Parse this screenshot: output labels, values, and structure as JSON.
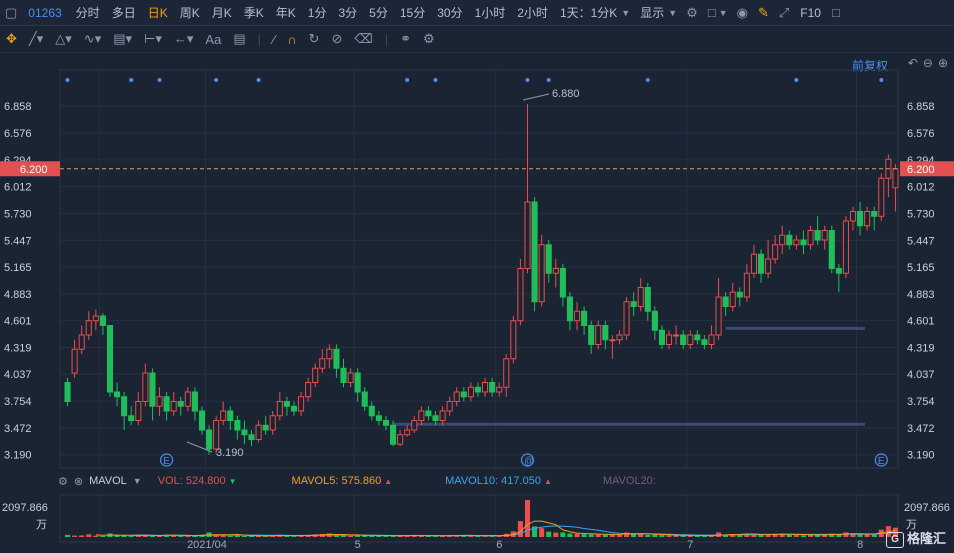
{
  "toolbar": {
    "symbol": "01263",
    "periods": [
      "分时",
      "多日",
      "日K",
      "周K",
      "月K",
      "季K",
      "年K",
      "1分",
      "3分",
      "5分",
      "15分",
      "30分",
      "1小时",
      "2小时"
    ],
    "active_period": "日K",
    "combo_label": "1天：1分K",
    "display_label": "显示",
    "f10_label": "F10"
  },
  "adjust_label": "前复权",
  "price_axis": {
    "ticks": [
      "6.858",
      "6.576",
      "6.294",
      "6.012",
      "5.730",
      "5.447",
      "5.165",
      "4.883",
      "4.601",
      "4.319",
      "4.037",
      "3.754",
      "3.472",
      "3.190"
    ],
    "current_price": "6.200"
  },
  "annotations": {
    "high": "6.880",
    "low": "3.190"
  },
  "event_markers": [
    "E",
    "@",
    "E"
  ],
  "x_axis": {
    "labels": [
      "2021/04",
      "5",
      "6",
      "7",
      "8"
    ]
  },
  "volume_panel": {
    "indicator": "MAVOL",
    "vol": "VOL: 524.800",
    "mavol5": "MAVOL5: 575.860",
    "mavol10": "MAVOL10: 417.050",
    "mavol20": "MAVOL20:",
    "max_label": "2097.866",
    "unit": "万"
  },
  "colors": {
    "up": "#ec4d4d",
    "down": "#1fbe5a",
    "mavol5": "#f0a020",
    "mavol10": "#3ca5f0",
    "mavol20": "#c66bd1",
    "accent": "#4d8ef0"
  },
  "chart_data": {
    "type": "candlestick",
    "ylim": [
      3.05,
      7.05
    ],
    "candles": [
      [
        3.95,
        3.75,
        4.0,
        3.7
      ],
      [
        4.05,
        4.3,
        4.4,
        4.0
      ],
      [
        4.3,
        4.45,
        4.55,
        4.25
      ],
      [
        4.45,
        4.6,
        4.7,
        4.4
      ],
      [
        4.6,
        4.65,
        4.72,
        4.5
      ],
      [
        4.65,
        4.55,
        4.68,
        4.45
      ],
      [
        4.55,
        3.85,
        4.55,
        3.8
      ],
      [
        3.85,
        3.8,
        3.95,
        3.7
      ],
      [
        3.8,
        3.6,
        3.85,
        3.45
      ],
      [
        3.6,
        3.55,
        3.7,
        3.5
      ],
      [
        3.55,
        3.75,
        3.85,
        3.5
      ],
      [
        3.75,
        4.05,
        4.15,
        3.7
      ],
      [
        4.05,
        3.7,
        4.1,
        3.55
      ],
      [
        3.7,
        3.8,
        3.9,
        3.6
      ],
      [
        3.8,
        3.65,
        3.85,
        3.55
      ],
      [
        3.65,
        3.75,
        3.85,
        3.6
      ],
      [
        3.75,
        3.7,
        3.8,
        3.6
      ],
      [
        3.7,
        3.85,
        3.9,
        3.65
      ],
      [
        3.85,
        3.65,
        3.9,
        3.55
      ],
      [
        3.65,
        3.45,
        3.7,
        3.4
      ],
      [
        3.45,
        3.25,
        3.5,
        3.19
      ],
      [
        3.25,
        3.55,
        3.6,
        3.2
      ],
      [
        3.55,
        3.65,
        3.75,
        3.5
      ],
      [
        3.65,
        3.55,
        3.7,
        3.45
      ],
      [
        3.55,
        3.45,
        3.6,
        3.35
      ],
      [
        3.45,
        3.4,
        3.55,
        3.3
      ],
      [
        3.4,
        3.35,
        3.45,
        3.28
      ],
      [
        3.35,
        3.5,
        3.55,
        3.32
      ],
      [
        3.5,
        3.45,
        3.6,
        3.4
      ],
      [
        3.45,
        3.6,
        3.65,
        3.4
      ],
      [
        3.6,
        3.75,
        3.85,
        3.55
      ],
      [
        3.75,
        3.7,
        3.8,
        3.6
      ],
      [
        3.7,
        3.65,
        3.75,
        3.6
      ],
      [
        3.65,
        3.8,
        3.85,
        3.6
      ],
      [
        3.8,
        3.95,
        4.0,
        3.75
      ],
      [
        3.95,
        4.1,
        4.15,
        3.9
      ],
      [
        4.1,
        4.2,
        4.3,
        4.05
      ],
      [
        4.2,
        4.3,
        4.35,
        4.1
      ],
      [
        4.3,
        4.1,
        4.35,
        4.0
      ],
      [
        4.1,
        3.95,
        4.2,
        3.9
      ],
      [
        3.95,
        4.05,
        4.1,
        3.9
      ],
      [
        4.05,
        3.85,
        4.1,
        3.75
      ],
      [
        3.85,
        3.7,
        3.9,
        3.65
      ],
      [
        3.7,
        3.6,
        3.75,
        3.55
      ],
      [
        3.6,
        3.55,
        3.65,
        3.5
      ],
      [
        3.55,
        3.5,
        3.6,
        3.45
      ],
      [
        3.5,
        3.3,
        3.55,
        3.28
      ],
      [
        3.3,
        3.4,
        3.45,
        3.28
      ],
      [
        3.4,
        3.45,
        3.5,
        3.38
      ],
      [
        3.45,
        3.55,
        3.6,
        3.42
      ],
      [
        3.55,
        3.65,
        3.7,
        3.5
      ],
      [
        3.65,
        3.6,
        3.7,
        3.55
      ],
      [
        3.6,
        3.55,
        3.65,
        3.5
      ],
      [
        3.55,
        3.65,
        3.7,
        3.5
      ],
      [
        3.65,
        3.75,
        3.8,
        3.6
      ],
      [
        3.75,
        3.85,
        3.9,
        3.7
      ],
      [
        3.85,
        3.8,
        3.9,
        3.75
      ],
      [
        3.8,
        3.9,
        3.95,
        3.75
      ],
      [
        3.9,
        3.85,
        3.95,
        3.8
      ],
      [
        3.85,
        3.95,
        4.0,
        3.8
      ],
      [
        3.95,
        3.85,
        4.0,
        3.8
      ],
      [
        3.85,
        3.9,
        3.95,
        3.8
      ],
      [
        3.9,
        4.2,
        4.25,
        3.8
      ],
      [
        4.2,
        4.6,
        4.65,
        4.15
      ],
      [
        4.6,
        5.15,
        5.25,
        4.55
      ],
      [
        5.15,
        5.85,
        6.88,
        5.1
      ],
      [
        5.85,
        4.8,
        5.9,
        4.7
      ],
      [
        4.8,
        5.4,
        5.5,
        4.75
      ],
      [
        5.4,
        5.1,
        5.45,
        5.0
      ],
      [
        5.1,
        5.15,
        5.25,
        4.95
      ],
      [
        5.15,
        4.85,
        5.2,
        4.75
      ],
      [
        4.85,
        4.6,
        4.9,
        4.5
      ],
      [
        4.6,
        4.7,
        4.8,
        4.5
      ],
      [
        4.7,
        4.55,
        4.75,
        4.45
      ],
      [
        4.55,
        4.35,
        4.6,
        4.25
      ],
      [
        4.35,
        4.55,
        4.6,
        4.3
      ],
      [
        4.55,
        4.4,
        4.6,
        4.3
      ],
      [
        4.4,
        4.4,
        4.45,
        4.2
      ],
      [
        4.4,
        4.45,
        4.5,
        4.35
      ],
      [
        4.45,
        4.8,
        4.85,
        4.4
      ],
      [
        4.8,
        4.75,
        4.9,
        4.65
      ],
      [
        4.75,
        4.95,
        5.05,
        4.7
      ],
      [
        4.95,
        4.7,
        5.0,
        4.6
      ],
      [
        4.7,
        4.5,
        4.75,
        4.4
      ],
      [
        4.5,
        4.35,
        4.55,
        4.3
      ],
      [
        4.35,
        4.45,
        4.5,
        4.3
      ],
      [
        4.45,
        4.45,
        4.55,
        4.35
      ],
      [
        4.45,
        4.35,
        4.5,
        4.3
      ],
      [
        4.35,
        4.45,
        4.5,
        4.3
      ],
      [
        4.45,
        4.4,
        4.5,
        4.35
      ],
      [
        4.4,
        4.35,
        4.45,
        4.3
      ],
      [
        4.35,
        4.45,
        4.55,
        4.3
      ],
      [
        4.45,
        4.85,
        5.05,
        4.4
      ],
      [
        4.85,
        4.75,
        4.9,
        4.65
      ],
      [
        4.75,
        4.9,
        5.0,
        4.7
      ],
      [
        4.9,
        4.85,
        4.95,
        4.75
      ],
      [
        4.85,
        5.1,
        5.2,
        4.8
      ],
      [
        5.1,
        5.3,
        5.4,
        5.05
      ],
      [
        5.3,
        5.1,
        5.35,
        5.0
      ],
      [
        5.1,
        5.25,
        5.45,
        5.05
      ],
      [
        5.25,
        5.4,
        5.5,
        5.2
      ],
      [
        5.4,
        5.5,
        5.6,
        5.3
      ],
      [
        5.5,
        5.4,
        5.55,
        5.35
      ],
      [
        5.4,
        5.45,
        5.5,
        5.35
      ],
      [
        5.45,
        5.4,
        5.55,
        5.3
      ],
      [
        5.4,
        5.55,
        5.6,
        5.35
      ],
      [
        5.55,
        5.45,
        5.7,
        5.4
      ],
      [
        5.45,
        5.55,
        5.6,
        5.35
      ],
      [
        5.55,
        5.15,
        5.6,
        5.1
      ],
      [
        5.15,
        5.1,
        5.2,
        4.9
      ],
      [
        5.1,
        5.65,
        5.7,
        5.05
      ],
      [
        5.65,
        5.75,
        5.8,
        5.55
      ],
      [
        5.75,
        5.6,
        5.85,
        5.5
      ],
      [
        5.6,
        5.75,
        5.8,
        5.55
      ],
      [
        5.75,
        5.7,
        5.8,
        5.55
      ],
      [
        5.7,
        6.1,
        6.15,
        5.65
      ],
      [
        6.1,
        6.3,
        6.35,
        5.9
      ],
      [
        6.0,
        6.2,
        6.25,
        5.75
      ]
    ],
    "volumes": [
      120,
      80,
      90,
      150,
      70,
      60,
      200,
      90,
      100,
      60,
      80,
      140,
      70,
      90,
      60,
      80,
      70,
      90,
      60,
      100,
      260,
      150,
      90,
      70,
      80,
      60,
      70,
      90,
      60,
      80,
      130,
      70,
      60,
      90,
      120,
      150,
      170,
      200,
      80,
      100,
      70,
      90,
      100,
      60,
      80,
      70,
      110,
      60,
      70,
      80,
      90,
      60,
      70,
      80,
      90,
      100,
      80,
      70,
      60,
      90,
      70,
      60,
      180,
      320,
      900,
      2097,
      600,
      500,
      300,
      250,
      260,
      200,
      180,
      160,
      150,
      140,
      130,
      170,
      120,
      260,
      150,
      200,
      120,
      140,
      110,
      100,
      90,
      80,
      90,
      80,
      70,
      90,
      260,
      130,
      140,
      120,
      180,
      190,
      120,
      150,
      170,
      200,
      120,
      110,
      100,
      130,
      150,
      110,
      190,
      140,
      260,
      200,
      150,
      160,
      140,
      420,
      620,
      525
    ],
    "ma5": [
      null,
      null,
      null,
      null,
      120,
      95,
      115,
      110,
      100,
      90,
      100,
      90,
      90,
      80,
      100,
      110,
      90,
      90,
      70,
      100,
      120,
      130,
      130,
      130,
      140,
      110,
      80,
      70,
      75,
      70,
      85,
      85,
      80,
      85,
      90,
      100,
      120,
      150,
      140,
      140,
      120,
      120,
      100,
      90,
      90,
      85,
      80,
      75,
      80,
      90,
      80,
      80,
      80,
      75,
      80,
      85,
      90,
      90,
      80,
      80,
      80,
      70,
      90,
      150,
      300,
      700,
      900,
      900,
      800,
      700,
      400,
      300,
      220,
      200,
      180,
      170,
      150,
      150,
      150,
      170,
      170,
      190,
      180,
      160,
      150,
      130,
      110,
      100,
      90,
      90,
      80,
      80,
      110,
      120,
      140,
      150,
      170,
      170,
      150,
      150,
      150,
      160,
      160,
      150,
      140,
      130,
      120,
      120,
      140,
      140,
      170,
      180,
      180,
      170,
      170,
      230,
      300,
      380
    ],
    "ma10": [
      null,
      null,
      null,
      null,
      null,
      null,
      null,
      null,
      null,
      110,
      105,
      105,
      100,
      90,
      95,
      100,
      95,
      90,
      85,
      90,
      100,
      110,
      110,
      110,
      110,
      110,
      110,
      110,
      100,
      100,
      95,
      90,
      85,
      85,
      85,
      90,
      100,
      110,
      110,
      110,
      110,
      110,
      105,
      100,
      95,
      90,
      85,
      85,
      85,
      85,
      85,
      85,
      80,
      80,
      80,
      80,
      80,
      80,
      80,
      80,
      80,
      80,
      85,
      115,
      190,
      390,
      490,
      560,
      610,
      630,
      610,
      590,
      550,
      480,
      430,
      380,
      310,
      250,
      210,
      200,
      190,
      185,
      180,
      175,
      165,
      155,
      140,
      130,
      120,
      110,
      105,
      105,
      110,
      115,
      120,
      125,
      130,
      135,
      135,
      140,
      145,
      150,
      150,
      150,
      145,
      145,
      145,
      145,
      145,
      150,
      155,
      160,
      160,
      160,
      160,
      180,
      200,
      230
    ]
  }
}
